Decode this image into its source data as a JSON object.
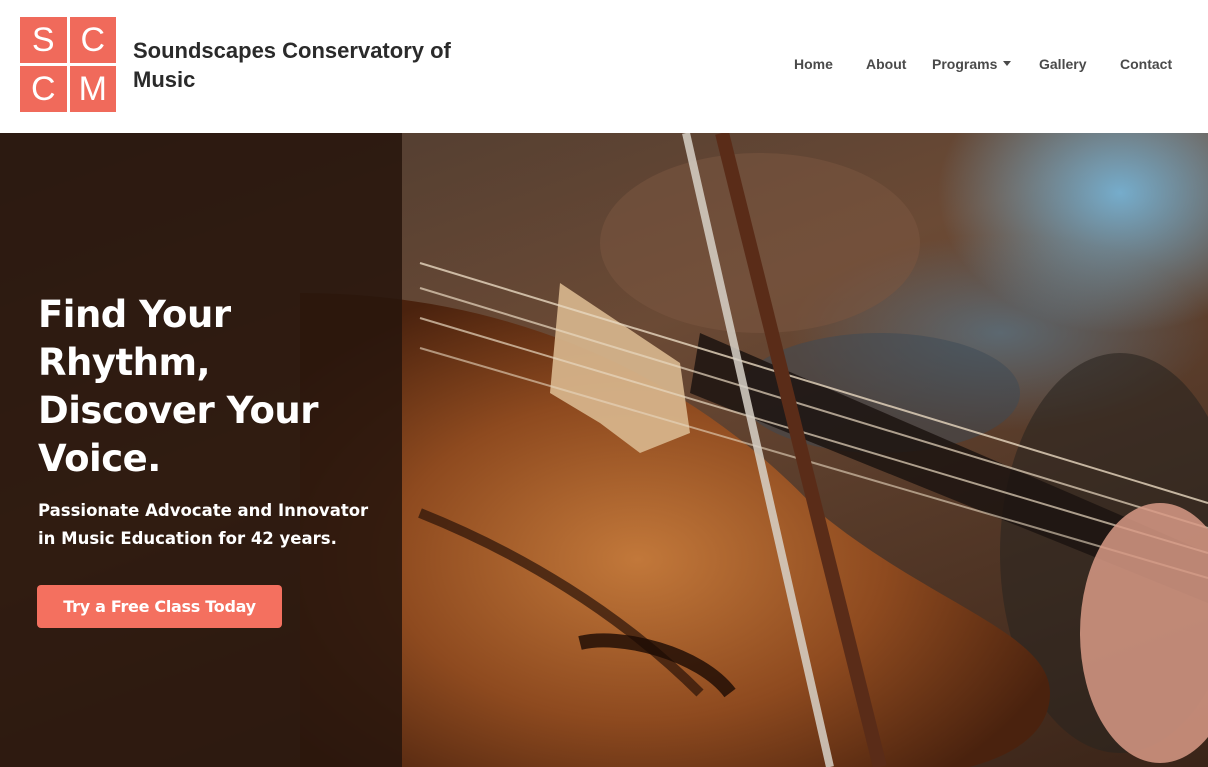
{
  "brand": {
    "logo_letters": [
      "S",
      "C",
      "C",
      "M"
    ],
    "name": "Soundscapes Conservatory of Music",
    "accent_color": "#f06a5b"
  },
  "nav": {
    "items": [
      {
        "label": "Home"
      },
      {
        "label": "About"
      },
      {
        "label": "Programs",
        "has_dropdown": true
      },
      {
        "label": "Gallery"
      },
      {
        "label": "Contact"
      }
    ]
  },
  "hero": {
    "title": "Find Your Rhythm, Discover Your Voice.",
    "subtitle": "Passionate Advocate and Innovator in Music Education for 42 years.",
    "cta_label": "Try a Free Class Today",
    "cta_color": "#f4705f",
    "image_subject": "close-up of violin being played with bow"
  }
}
